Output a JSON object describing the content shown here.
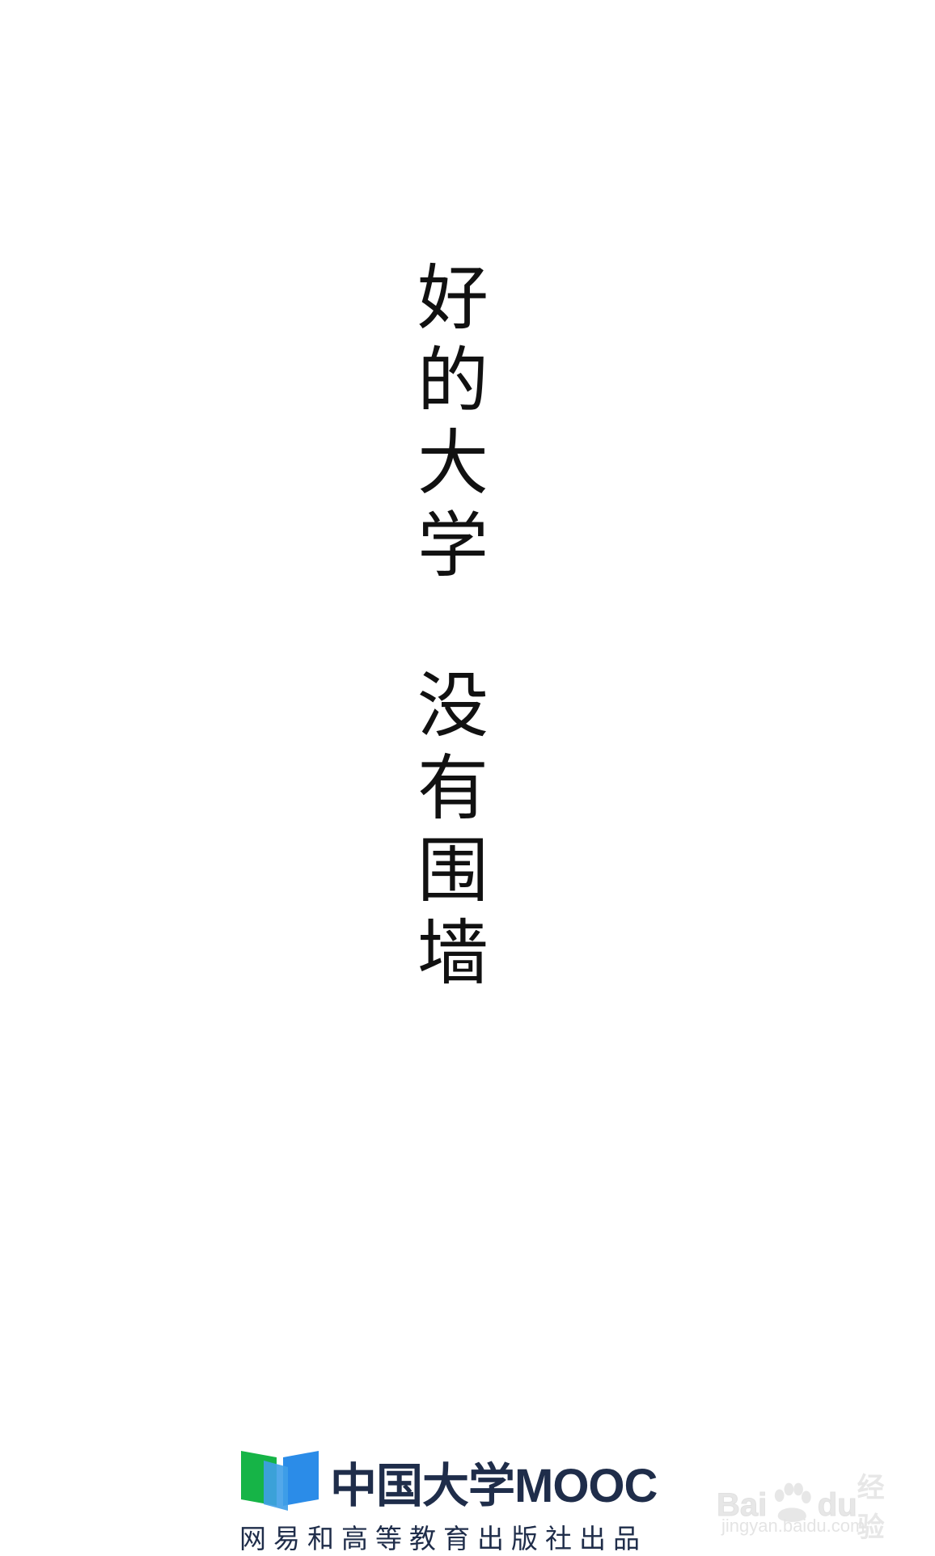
{
  "slogan": {
    "part1": [
      "好",
      "的",
      "大",
      "学"
    ],
    "part2": [
      "没",
      "有",
      "围",
      "墙"
    ]
  },
  "brand": {
    "name": "中国大学MOOC",
    "publisher": "网易和高等教育出版社出品",
    "colors": {
      "logo_green": "#16b447",
      "logo_blue": "#2b8ce8",
      "text_navy": "#1f2d4a"
    }
  },
  "watermark": {
    "brand_bai": "Bai",
    "brand_du": "du",
    "jingyan": "经验",
    "url": "jingyan.baidu.com"
  }
}
